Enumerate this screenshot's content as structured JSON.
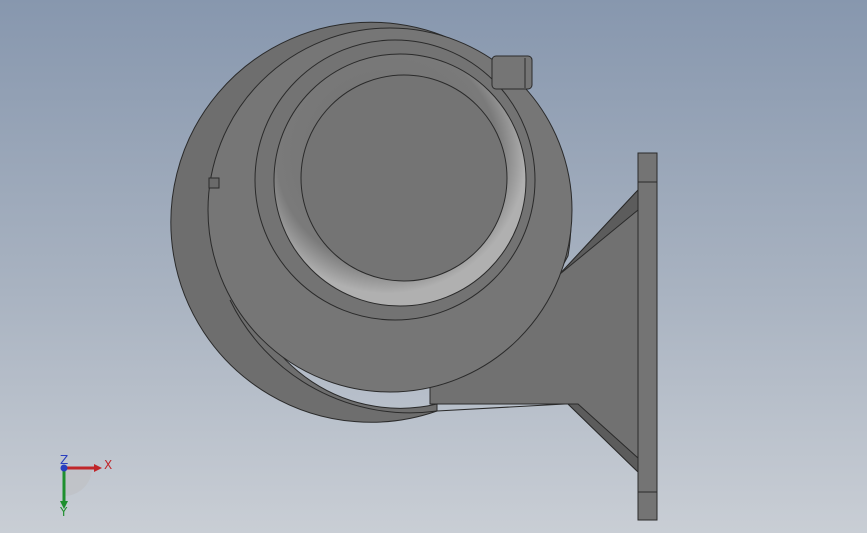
{
  "viewport": {
    "background_top": "#8797ae",
    "background_bottom": "#c9ced5"
  },
  "model": {
    "part_color": "#727272",
    "edge_color": "#2a2a2a"
  },
  "triad": {
    "x_label": "X",
    "y_label": "Y",
    "z_label": "Z",
    "x_color": "#c0262a",
    "y_color": "#1e8f2e",
    "z_color": "#2a3fbf"
  }
}
